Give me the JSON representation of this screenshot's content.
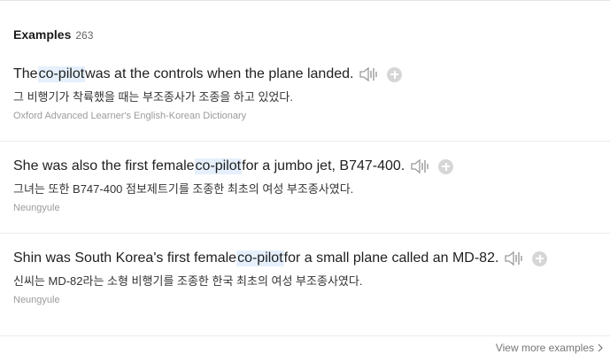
{
  "header": {
    "title": "Examples",
    "count": "263"
  },
  "examples": [
    {
      "en_before": "The ",
      "en_highlight": "co-pilot",
      "en_after": " was at the controls when the plane landed.",
      "ko": "그 비행기가 착륙했을 때는 부조종사가 조종을 하고 있었다.",
      "source": "Oxford Advanced Learner's English-Korean Dictionary"
    },
    {
      "en_before": "She was also the first female ",
      "en_highlight": "co-pilot",
      "en_after": " for a jumbo jet, B747-400.",
      "ko": "그녀는 또한 B747-400 점보제트기를 조종한 최초의 여성 부조종사였다.",
      "source": "Neungyule"
    },
    {
      "en_before": "Shin was South Korea's first female ",
      "en_highlight": "co-pilot",
      "en_after": " for a small plane called an MD-82.",
      "ko": "신씨는 MD-82라는 소형 비행기를 조종한 한국 최초의 여성 부조종사였다.",
      "source": "Neungyule"
    }
  ],
  "footer": {
    "more_label": "View more examples"
  },
  "colors": {
    "highlight": "#e5f0fc",
    "icon_gray": "#9a9a9a",
    "plus_gray": "#d6d6d6"
  },
  "icons": {
    "play": "speaker-icon",
    "add": "plus-circle-icon",
    "more": "chevron-right-icon"
  }
}
